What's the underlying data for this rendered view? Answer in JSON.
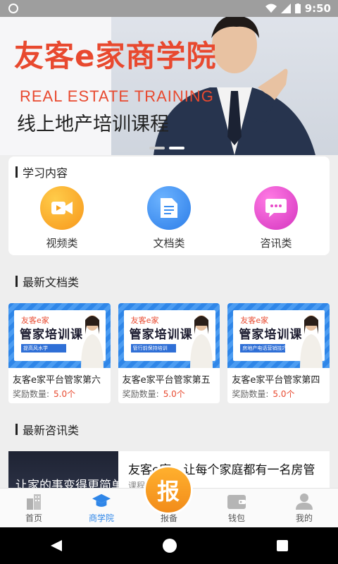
{
  "status_bar": {
    "time": "9:50"
  },
  "banner": {
    "title": "友客e家商学院",
    "subtitle_en": "REAL ESTATE TRAINING",
    "subtitle": "线上地产培训课程"
  },
  "learning": {
    "title": "学习内容",
    "items": [
      {
        "label": "视频类",
        "icon": "video-icon",
        "color": "#f7a21b"
      },
      {
        "label": "文档类",
        "icon": "document-icon",
        "color": "#3b8ef0"
      },
      {
        "label": "咨讯类",
        "icon": "chat-icon",
        "color": "#e848c8"
      }
    ]
  },
  "docs_section": {
    "title": "最新文档类",
    "reward_label": "奖励数量:",
    "items": [
      {
        "brand": "友客e家",
        "head": "管家培训课",
        "tag": "提高风水学",
        "title": "友客e家平台管家第六",
        "reward": "5.0个"
      },
      {
        "brand": "友客e家",
        "head": "管家培训课",
        "tag": "管行前保持培训",
        "title": "友客e家平台管家第五",
        "reward": "5.0个"
      },
      {
        "brand": "友客e家",
        "head": "管家培训课",
        "tag": "房地产电话营销技巧",
        "title": "友客e家平台管家第四",
        "reward": "5.0个"
      }
    ]
  },
  "news_section": {
    "title": "最新咨讯类",
    "image_text": "让家的事变得更简单",
    "item_title": "友客e家，让每个家庭都有一名房管",
    "item_sub": "课程"
  },
  "tabbar": {
    "items": [
      {
        "label": "首页",
        "icon": "building-icon"
      },
      {
        "label": "商学院",
        "icon": "graduation-cap-icon",
        "active": true
      },
      {
        "label": "报备",
        "icon": "report-icon"
      },
      {
        "label": "钱包",
        "icon": "wallet-icon"
      },
      {
        "label": "我的",
        "icon": "person-icon"
      }
    ],
    "report_glyph": "报"
  },
  "colors": {
    "accent": "#2f86e8",
    "brand_red": "#e8492f",
    "orange": "#f7a21b"
  }
}
